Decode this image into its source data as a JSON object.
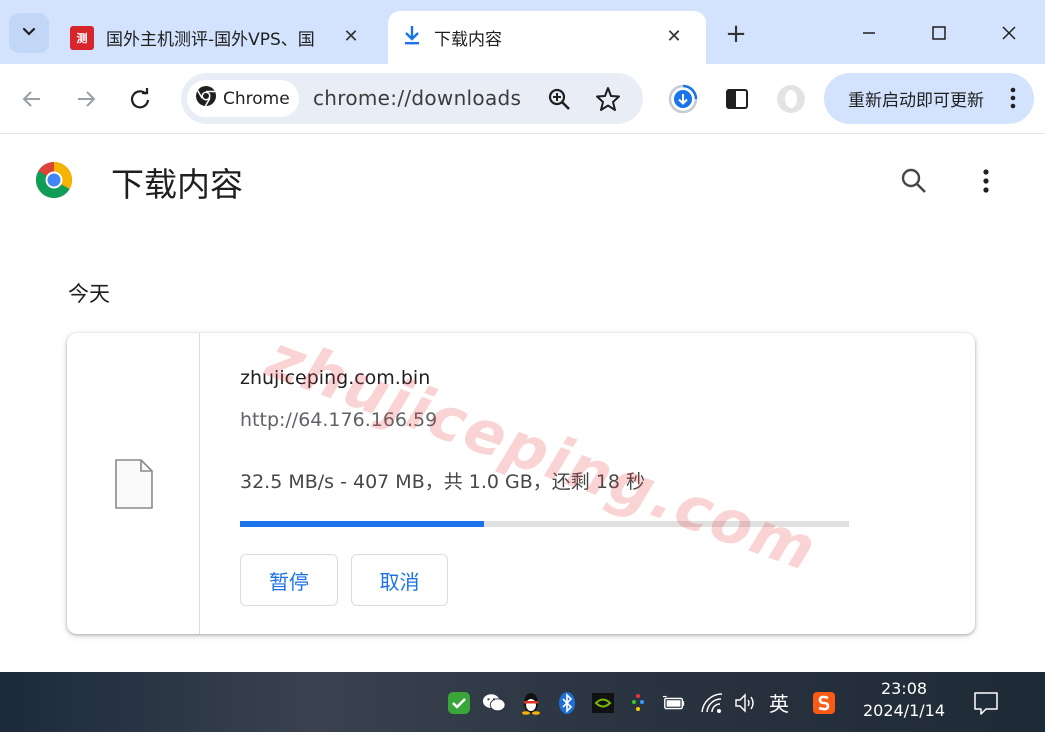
{
  "tabs": [
    {
      "title": "国外主机测评-国外VPS、国",
      "favicon": "site-favicon",
      "active": false
    },
    {
      "title": "下载内容",
      "favicon": "download-arrow-icon",
      "active": true
    }
  ],
  "toolbar": {
    "chip_label": "Chrome",
    "url": "chrome://downloads",
    "update_label": "重新启动即可更新"
  },
  "page": {
    "title": "下载内容",
    "section_label": "今天"
  },
  "download": {
    "filename": "zhujiceping.com.bin",
    "source_url": "http://64.176.166.59",
    "status": "32.5 MB/s - 407 MB，共 1.0 GB，还剩 18 秒",
    "progress_fraction": 0.4,
    "pause_label": "暂停",
    "cancel_label": "取消"
  },
  "watermark": "zhujiceping.com",
  "taskbar": {
    "ime": "英",
    "time": "23:08",
    "date": "2024/1/14"
  },
  "colors": {
    "accent": "#1a73e8",
    "tabstrip": "#d3e3fd",
    "omnibox": "#e9eef6"
  }
}
